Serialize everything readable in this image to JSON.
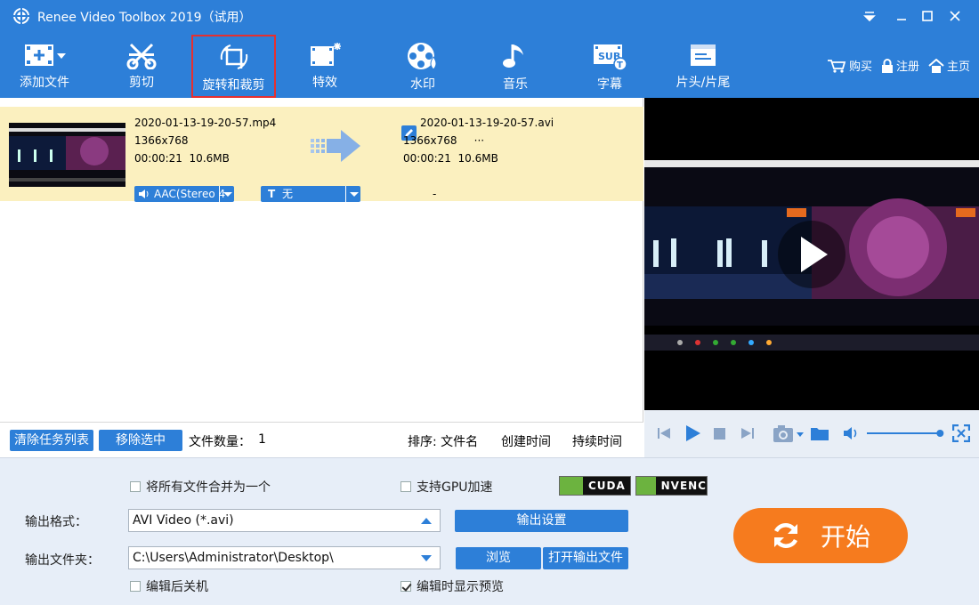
{
  "window": {
    "title": "Renee Video Toolbox 2019（试用）",
    "controls": [
      "pin-icon",
      "minimize-icon",
      "maximize-icon",
      "close-icon"
    ]
  },
  "toolbar": {
    "items": [
      {
        "label": "添加文件",
        "icon": "add-file-icon"
      },
      {
        "label": "剪切",
        "icon": "scissors-icon"
      },
      {
        "label": "旋转和裁剪",
        "icon": "crop-rotate-icon",
        "selected": true
      },
      {
        "label": "特效",
        "icon": "effects-icon"
      },
      {
        "label": "水印",
        "icon": "watermark-icon"
      },
      {
        "label": "音乐",
        "icon": "music-note-icon"
      },
      {
        "label": "字幕",
        "icon": "subtitle-icon"
      },
      {
        "label": "片头/片尾",
        "icon": "intro-outro-icon"
      }
    ],
    "right_links": [
      {
        "label": "购买",
        "icon": "cart-icon"
      },
      {
        "label": "注册",
        "icon": "lock-icon"
      },
      {
        "label": "主页",
        "icon": "home-icon"
      }
    ]
  },
  "file": {
    "source": {
      "name": "2020-01-13-19-20-57.mp4",
      "resolution": "1366x768",
      "duration": "00:00:21",
      "size": "10.6MB"
    },
    "output": {
      "name": "2020-01-13-19-20-57.avi",
      "resolution": "1366x768",
      "more": "···",
      "duration": "00:00:21",
      "size": "10.6MB"
    },
    "audio_track": "AAC(Stereo 4",
    "subtitle_track": "无",
    "subtitle_status": "-"
  },
  "list_footer": {
    "clear_label": "清除任务列表",
    "remove_label": "移除选中",
    "count_label": "文件数量：",
    "count_value": "1",
    "sort_label": "排序: 文件名",
    "sort_created": "创建时间",
    "sort_duration": "持续时间"
  },
  "settings": {
    "merge_label": "将所有文件合并为一个",
    "merge_checked": false,
    "gpu_label": "支持GPU加速",
    "gpu_checked": false,
    "cuda_label": "CUDA",
    "nvenc_label": "NVENC",
    "format_label": "输出格式：",
    "format_value": "AVI Video (*.avi)",
    "output_settings_label": "输出设置",
    "folder_label": "输出文件夹：",
    "folder_value": "C:\\Users\\Administrator\\Desktop\\",
    "browse_label": "浏览",
    "open_folder_label": "打开输出文件",
    "shutdown_label": "编辑后关机",
    "shutdown_checked": false,
    "preview_label": "编辑时显示预览",
    "preview_checked": true,
    "start_label": "开始"
  },
  "player": {
    "volume_level": 0.98
  },
  "colors": {
    "brand_blue": "#2d7fd8",
    "row_highlight": "#fbf0bf",
    "start_orange": "#f67b1e",
    "selected_border": "#e53030"
  }
}
